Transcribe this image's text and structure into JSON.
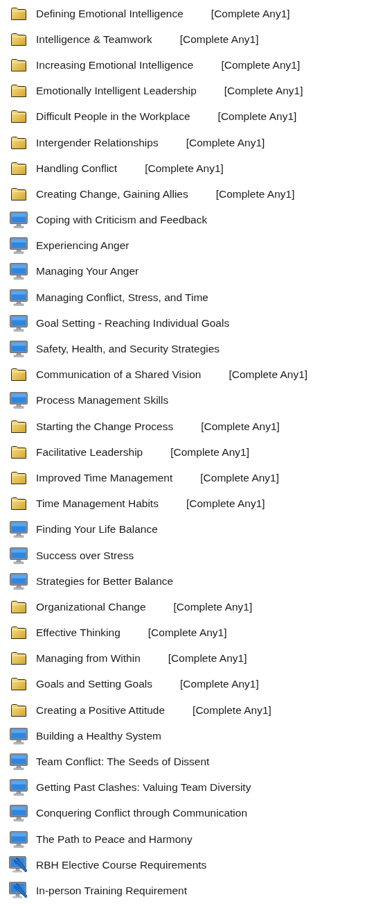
{
  "items": [
    {
      "kind": "folder",
      "title": "Defining Emotional Intelligence",
      "requirement": "[Complete Any1]"
    },
    {
      "kind": "folder",
      "title": "Intelligence & Teamwork",
      "requirement": "[Complete Any1]"
    },
    {
      "kind": "folder",
      "title": "Increasing Emotional Intelligence",
      "requirement": "[Complete Any1]"
    },
    {
      "kind": "folder",
      "title": "Emotionally Intelligent Leadership",
      "requirement": "[Complete Any1]"
    },
    {
      "kind": "folder",
      "title": "Difficult People in the Workplace",
      "requirement": "[Complete Any1]"
    },
    {
      "kind": "folder",
      "title": "Intergender Relationships",
      "requirement": "[Complete Any1]"
    },
    {
      "kind": "folder",
      "title": "Handling Conflict",
      "requirement": "[Complete Any1]"
    },
    {
      "kind": "folder",
      "title": "Creating Change, Gaining Allies",
      "requirement": "[Complete Any1]"
    },
    {
      "kind": "course",
      "title": "Coping with Criticism and Feedback"
    },
    {
      "kind": "course",
      "title": "Experiencing Anger"
    },
    {
      "kind": "course",
      "title": "Managing Your Anger"
    },
    {
      "kind": "course",
      "title": "Managing Conflict, Stress, and Time"
    },
    {
      "kind": "course",
      "title": "Goal Setting - Reaching Individual Goals"
    },
    {
      "kind": "course",
      "title": "Safety, Health, and Security Strategies"
    },
    {
      "kind": "folder",
      "title": "Communication of a Shared Vision",
      "requirement": "[Complete Any1]"
    },
    {
      "kind": "course",
      "title": "Process Management Skills"
    },
    {
      "kind": "folder",
      "title": "Starting the Change Process",
      "requirement": "[Complete Any1]"
    },
    {
      "kind": "folder",
      "title": "Facilitative Leadership",
      "requirement": "[Complete Any1]"
    },
    {
      "kind": "folder",
      "title": "Improved Time Management",
      "requirement": "[Complete Any1]"
    },
    {
      "kind": "folder",
      "title": "Time Management Habits",
      "requirement": "[Complete Any1]"
    },
    {
      "kind": "course",
      "title": "Finding Your Life Balance"
    },
    {
      "kind": "course",
      "title": "Success over Stress"
    },
    {
      "kind": "course",
      "title": "Strategies for Better Balance"
    },
    {
      "kind": "folder",
      "title": "Organizational Change",
      "requirement": "[Complete Any1]"
    },
    {
      "kind": "folder",
      "title": "Effective Thinking",
      "requirement": "[Complete Any1]"
    },
    {
      "kind": "folder",
      "title": "Managing from Within",
      "requirement": "[Complete Any1]"
    },
    {
      "kind": "folder",
      "title": "Goals and Setting Goals",
      "requirement": "[Complete Any1]"
    },
    {
      "kind": "folder",
      "title": "Creating a Positive Attitude",
      "requirement": "[Complete Any1]"
    },
    {
      "kind": "course",
      "title": "Building a Healthy System"
    },
    {
      "kind": "course",
      "title": "Team Conflict: The Seeds of Dissent"
    },
    {
      "kind": "course",
      "title": "Getting Past Clashes: Valuing Team Diversity"
    },
    {
      "kind": "course",
      "title": "Conquering Conflict through Communication"
    },
    {
      "kind": "course",
      "title": "The Path to Peace and Harmony"
    },
    {
      "kind": "tool",
      "title": "RBH Elective Course Requirements"
    },
    {
      "kind": "tool",
      "title": "In-person Training Requirement"
    }
  ]
}
